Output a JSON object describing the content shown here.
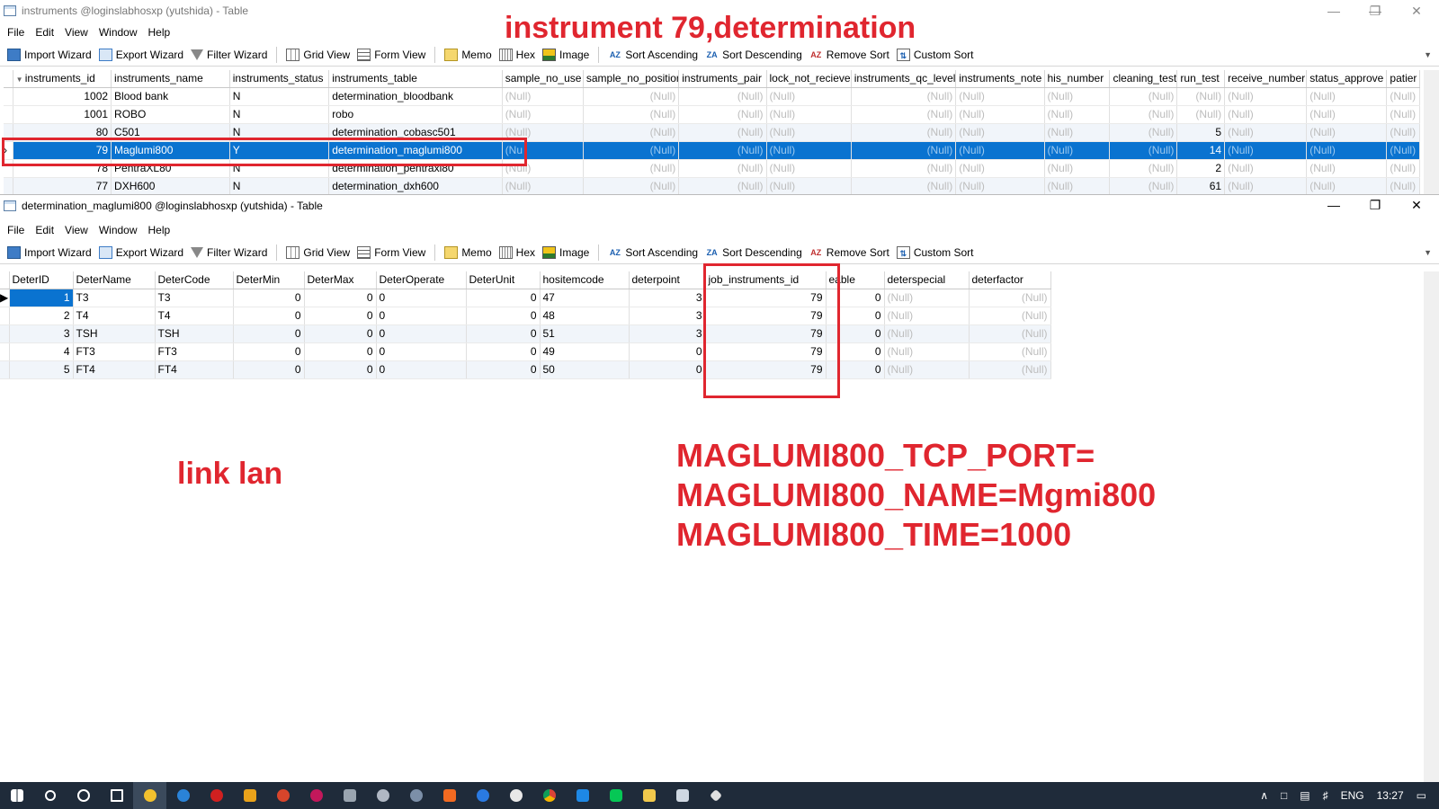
{
  "win1": {
    "title": "instruments @loginslabhosxp (yutshida) - Table",
    "menu": [
      "File",
      "Edit",
      "View",
      "Window",
      "Help"
    ],
    "toolbar": {
      "import": "Import Wizard",
      "export": "Export Wizard",
      "filter": "Filter Wizard",
      "grid": "Grid View",
      "form": "Form View",
      "memo": "Memo",
      "hex": "Hex",
      "image": "Image",
      "sort_asc": "Sort Ascending",
      "sort_desc": "Sort Descending",
      "remove_sort": "Remove Sort",
      "custom_sort": "Custom Sort"
    },
    "columns": [
      "instruments_id",
      "instruments_name",
      "instruments_status",
      "instruments_table",
      "sample_no_use",
      "sample_no_positior",
      "instruments_pair",
      "lock_not_recieve",
      "instruments_qc_level",
      "instruments_note",
      "his_number",
      "cleaning_test",
      "run_test",
      "receive_number",
      "status_approve",
      "patier"
    ],
    "rows": [
      {
        "id": "1002",
        "name": "Blood bank",
        "status": "N",
        "table": "determination_bloodbank",
        "run": ""
      },
      {
        "id": "1001",
        "name": "ROBO",
        "status": "N",
        "table": "robo",
        "run": "(Null)"
      },
      {
        "id": "80",
        "name": "C501",
        "status": "N",
        "table": "determination_cobasc501",
        "run": "5"
      },
      {
        "id": "79",
        "name": "Maglumi800",
        "status": "Y",
        "table": "determination_maglumi800",
        "run": "14"
      },
      {
        "id": "78",
        "name": "PentraXL80",
        "status": "N",
        "table": "determination_pentraxl80",
        "run": "2"
      },
      {
        "id": "77",
        "name": "DXH600",
        "status": "N",
        "table": "determination_dxh600",
        "run": "61"
      }
    ],
    "null_text": "(Null)",
    "sel_partial": "(Nu"
  },
  "win2": {
    "title": "determination_maglumi800 @loginslabhosxp (yutshida) - Table",
    "menu": [
      "File",
      "Edit",
      "View",
      "Window",
      "Help"
    ],
    "toolbar": {
      "import": "Import Wizard",
      "export": "Export Wizard",
      "filter": "Filter Wizard",
      "grid": "Grid View",
      "form": "Form View",
      "memo": "Memo",
      "hex": "Hex",
      "image": "Image",
      "sort_asc": "Sort Ascending",
      "sort_desc": "Sort Descending",
      "remove_sort": "Remove Sort",
      "custom_sort": "Custom Sort"
    },
    "columns": [
      "DeterID",
      "DeterName",
      "DeterCode",
      "DeterMin",
      "DeterMax",
      "DeterOperate",
      "DeterUnit",
      "hositemcode",
      "deterpoint",
      "job_instruments_id",
      "eable",
      "deterspecial",
      "deterfactor"
    ],
    "rows": [
      {
        "id": "1",
        "name": "T3",
        "code": "T3",
        "min": "0",
        "max": "0",
        "op": "0",
        "unit": "0",
        "hos": "47",
        "point": "3",
        "job": "79",
        "enable": "0"
      },
      {
        "id": "2",
        "name": "T4",
        "code": "T4",
        "min": "0",
        "max": "0",
        "op": "0",
        "unit": "0",
        "hos": "48",
        "point": "3",
        "job": "79",
        "enable": "0"
      },
      {
        "id": "3",
        "name": "TSH",
        "code": "TSH",
        "min": "0",
        "max": "0",
        "op": "0",
        "unit": "0",
        "hos": "51",
        "point": "3",
        "job": "79",
        "enable": "0"
      },
      {
        "id": "4",
        "name": "FT3",
        "code": "FT3",
        "min": "0",
        "max": "0",
        "op": "0",
        "unit": "0",
        "hos": "49",
        "point": "0",
        "job": "79",
        "enable": "0"
      },
      {
        "id": "5",
        "name": "FT4",
        "code": "FT4",
        "min": "0",
        "max": "0",
        "op": "0",
        "unit": "0",
        "hos": "50",
        "point": "0",
        "job": "79",
        "enable": "0"
      }
    ],
    "null_text": "(Null)"
  },
  "annotations": {
    "heading": "instrument 79,determination",
    "link": "link lan",
    "config1": "MAGLUMI800_TCP_PORT=",
    "config2": "MAGLUMI800_NAME=Mgmi800",
    "config3": "MAGLUMI800_TIME=1000"
  },
  "taskbar": {
    "lang": "ENG",
    "time": "13:27"
  },
  "colors": {
    "annotation": "#e0262f",
    "selection": "#0a73d0",
    "taskbar": "#1f2b3a"
  }
}
